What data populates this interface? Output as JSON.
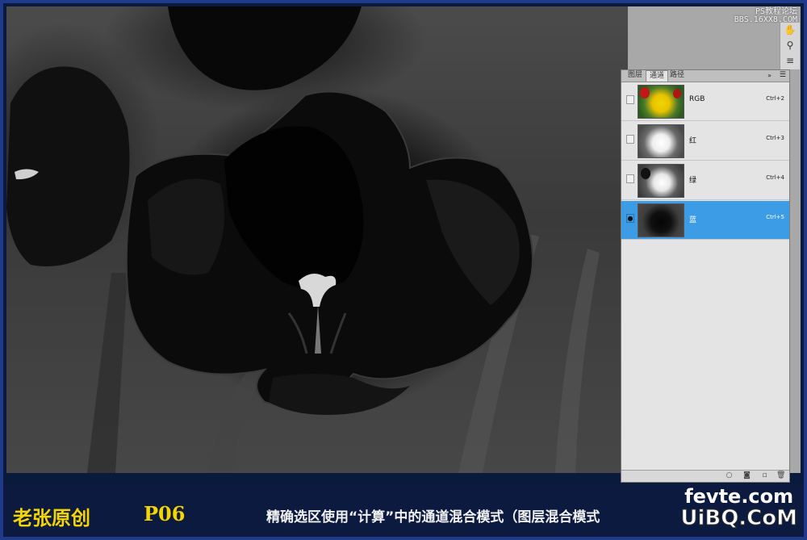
{
  "watermark_top": [
    "PS教程论坛",
    "BBS.16XX8.COM"
  ],
  "panel": {
    "tabs": [
      "图层",
      "通道",
      "路径"
    ],
    "active_tab": 1,
    "collapse_glyph": "»",
    "menu_glyph": "☰",
    "channels": [
      {
        "name": "RGB",
        "shortcut": "Ctrl+2",
        "visible": false,
        "selected": false
      },
      {
        "name": "红",
        "shortcut": "Ctrl+3",
        "visible": false,
        "selected": false
      },
      {
        "name": "绿",
        "shortcut": "Ctrl+4",
        "visible": false,
        "selected": false
      },
      {
        "name": "蓝",
        "shortcut": "Ctrl+5",
        "visible": true,
        "selected": true
      }
    ],
    "eye_glyph": "●",
    "footer_icons": [
      "load-selection-icon",
      "save-selection-icon",
      "new-channel-icon",
      "delete-channel-icon"
    ],
    "selected_color": "#3c9ce6"
  },
  "tools": [
    "hand-tool-icon",
    "usb-icon",
    "align-icon"
  ],
  "caption": {
    "author": "老张原创",
    "page": "P06",
    "description": "精确选区使用“计算”中的通道混合模式（图层混合模式",
    "accent_color": "#f4d500"
  },
  "watermark_bottom": {
    "line1": "fevte.com",
    "line2": "UiBQ.CoM"
  }
}
